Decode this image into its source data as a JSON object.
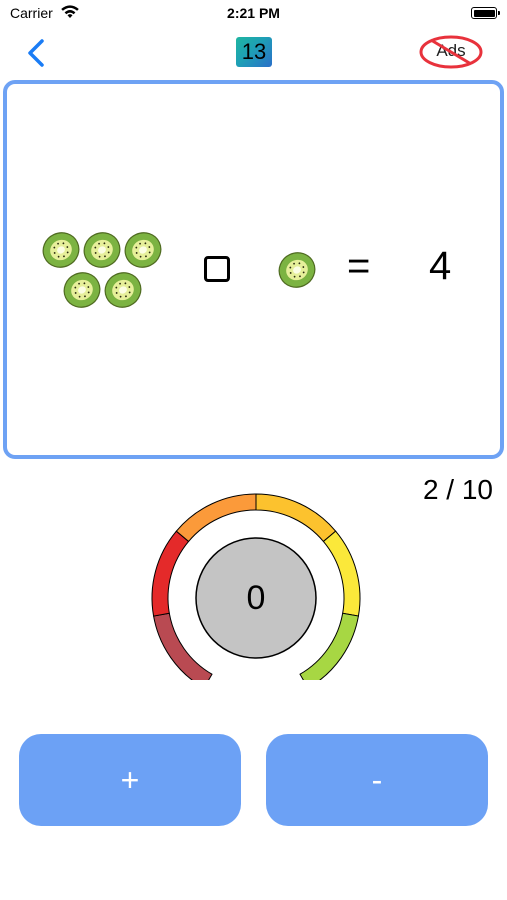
{
  "status_bar": {
    "carrier": "Carrier",
    "time": "2:21 PM"
  },
  "nav": {
    "level": "13",
    "no_ads_label": "Ads"
  },
  "question": {
    "left_count": 5,
    "operator_blank": "",
    "right_count": 1,
    "equals": "=",
    "result": "4"
  },
  "progress": "2 / 10",
  "dial": {
    "value": "0",
    "segment_colors": [
      "#b94a52",
      "#e42a2a",
      "#fb9a3a",
      "#fcc22e",
      "#fbe83a",
      "#a7d743"
    ],
    "center_color": "#c4c4c4"
  },
  "buttons": {
    "plus_label": "+",
    "minus_label": "-",
    "color": "#6ca1f5"
  },
  "colors": {
    "accent": "#6ea2f4",
    "back": "#1a7cf5",
    "no_ads_ring": "#e8323c",
    "kiwi_skin": "#7cb342",
    "kiwi_flesh": "#e6ef9a"
  }
}
